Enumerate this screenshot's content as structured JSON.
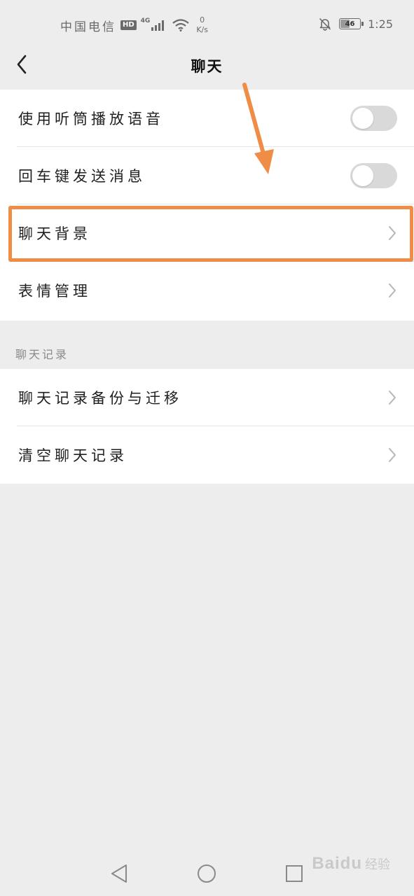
{
  "status_bar": {
    "carrier": "中国电信",
    "hd_badge": "HD",
    "network_type": "4G",
    "net_speed_value": "0",
    "net_speed_unit": "K/s",
    "battery_level": "46",
    "time": "1:25"
  },
  "nav": {
    "title": "聊天"
  },
  "settings_group_1": {
    "items": [
      {
        "label": "使用听筒播放语音",
        "control": "toggle",
        "on": false
      },
      {
        "label": "回车键发送消息",
        "control": "toggle",
        "on": false
      },
      {
        "label": "聊天背景",
        "control": "chevron"
      },
      {
        "label": "表情管理",
        "control": "chevron"
      }
    ]
  },
  "section_header": "聊天记录",
  "settings_group_2": {
    "items": [
      {
        "label": "聊天记录备份与迁移",
        "control": "chevron"
      },
      {
        "label": "清空聊天记录",
        "control": "chevron"
      }
    ]
  },
  "watermark": {
    "brand": "Baidu",
    "text": "经验"
  },
  "colors": {
    "background": "#ededed",
    "card": "#ffffff",
    "annotation": "#ef8c46",
    "toggle_off": "#d9d9d9"
  }
}
